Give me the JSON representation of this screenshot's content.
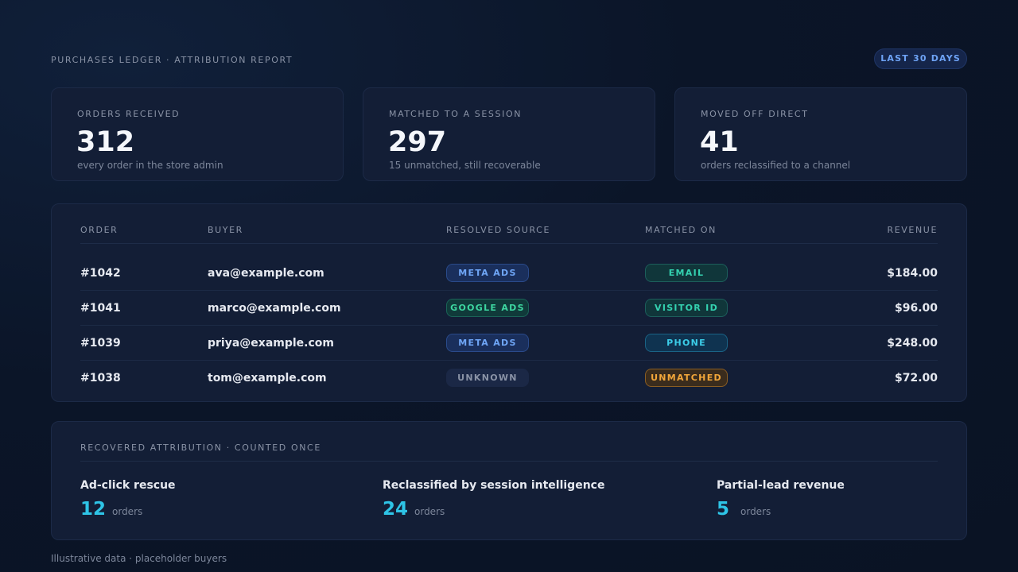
{
  "header": {
    "title": "PURCHASES LEDGER · ATTRIBUTION REPORT",
    "range": "LAST 30 DAYS"
  },
  "stats": [
    {
      "label": "ORDERS RECEIVED",
      "value": "312",
      "sub": "every order in the store admin"
    },
    {
      "label": "MATCHED TO A SESSION",
      "value": "297",
      "sub": "15 unmatched, still recoverable"
    },
    {
      "label": "MOVED OFF DIRECT",
      "value": "41",
      "sub": "orders reclassified to a channel"
    }
  ],
  "table": {
    "columns": [
      "ORDER",
      "BUYER",
      "RESOLVED SOURCE",
      "MATCHED ON",
      "REVENUE"
    ],
    "rows": [
      {
        "order": "#1042",
        "buyer": "ava@example.com",
        "source": "META ADS",
        "matched": "EMAIL",
        "revenue": "$184.00"
      },
      {
        "order": "#1041",
        "buyer": "marco@example.com",
        "source": "GOOGLE ADS",
        "matched": "VISITOR ID",
        "revenue": "$96.00"
      },
      {
        "order": "#1039",
        "buyer": "priya@example.com",
        "source": "META ADS",
        "matched": "PHONE",
        "revenue": "$248.00"
      },
      {
        "order": "#1038",
        "buyer": "tom@example.com",
        "source": "UNKNOWN",
        "matched": "UNMATCHED",
        "revenue": "$72.00"
      }
    ]
  },
  "recovered": {
    "title": "RECOVERED ATTRIBUTION · COUNTED ONCE",
    "items": [
      {
        "name": "Ad-click rescue",
        "value": "12",
        "unit": "orders"
      },
      {
        "name": "Reclassified by session intelligence",
        "value": "24",
        "unit": "orders"
      },
      {
        "name": "Partial-lead revenue",
        "value": "5",
        "unit": "orders"
      }
    ]
  },
  "footnote": "Illustrative data · placeholder buyers"
}
